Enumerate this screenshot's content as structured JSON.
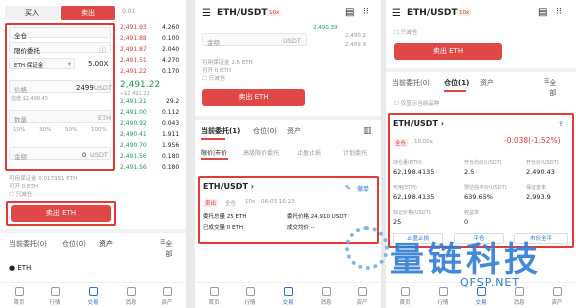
{
  "colors": {
    "sell": "#e04848",
    "buy": "#1f9d55",
    "accent": "#e53935"
  },
  "p1": {
    "tab_buy": "买入",
    "tab_sell": "卖出",
    "header_right": "0.01",
    "full_label": "全仓",
    "limit_label": "限价委托",
    "margin_label": "ETH 保证金",
    "leverage": "5.00X",
    "price_label": "价格",
    "price_value": "2499",
    "price_unit": "USDT",
    "price_approx": "估值 $2,499.45",
    "qty_label": "数量",
    "qty_unit": "ETH",
    "pcts": [
      "10%",
      "30%",
      "50%",
      "100%"
    ],
    "amount_label": "金额",
    "amount_value": "0",
    "amount_unit": "USDT",
    "avail_margin": "可用保证金 0.017351 ETH",
    "avail_open": "可开 0 ETH",
    "reduce_only": "只减仓",
    "sell_btn": "卖出 ETH",
    "orders_tab": "当前委托(0)",
    "positions_tab": "仓位(0)",
    "assets_tab": "资产",
    "all_label": "全部",
    "asset_name": "ETH",
    "asks": [
      [
        "2,491.93",
        "4.260"
      ],
      [
        "2,491.88",
        "0.100"
      ],
      [
        "2,491.87",
        "2.040"
      ],
      [
        "2,491.51",
        "4.270"
      ],
      [
        "2,491.22",
        "0.170"
      ]
    ],
    "last_price": "2,491.22",
    "last_sub": "≈$2,491.22",
    "bids": [
      [
        "2,491.21",
        "29.2"
      ],
      [
        "2,491.00",
        "0.112"
      ],
      [
        "2,490.92",
        "0.043"
      ],
      [
        "2,490.41",
        "1.911"
      ],
      [
        "2,490.70",
        "1.956"
      ],
      [
        "2,491.56",
        "0.180"
      ],
      [
        "2,491.56",
        "0.180"
      ]
    ],
    "nav": [
      "首页",
      "行情",
      "交易",
      "消息",
      "资产"
    ]
  },
  "p2": {
    "pair": "ETH/USDT",
    "lev_badge": "10x",
    "amount_label": "金额",
    "amount_unit": "USDT",
    "side_vals": [
      "2,490.39",
      "2,490.2",
      "2,489.9"
    ],
    "avail_margin": "可用保证金 2.5 ETH",
    "avail_open": "可开 0 ETH",
    "reduce_only": "只减仓",
    "sell_btn": "卖出 ETH",
    "orders_tab": "当前委托(1)",
    "positions_tab": "仓位(0)",
    "assets_tab": "资产",
    "subtabs": [
      "限价|市价",
      "高级限价委托",
      "止盈止损",
      "计划委托"
    ],
    "card_pair": "ETH/USDT",
    "card_link": "撤单",
    "card_side": "卖出",
    "card_mode": "全仓",
    "card_lev": "10x",
    "card_time": "08-03 16:23",
    "card_k1": "委托总量 25 ETH",
    "card_k2": "委托价格 24,910 USDT",
    "card_k3": "已成交量 0 ETH",
    "card_k4": "成交均价 --",
    "nav": [
      "首页",
      "行情",
      "交易",
      "消息",
      "资产"
    ]
  },
  "p3": {
    "pair": "ETH/USDT",
    "lev_badge": "10x",
    "reduce_only": "只减仓",
    "sell_btn": "卖出 ETH",
    "orders_tab": "当前委托(0)",
    "positions_tab": "仓位(1)",
    "assets_tab": "资产",
    "all_label": "全部",
    "show_current": "仅显示当前品种",
    "card_pair": "ETH/USDT",
    "card_mode": "全仓",
    "card_lev": "10.00x",
    "card_pnl": "-0.038(-1.52%)",
    "labels": [
      "持仓量(ETH)",
      "开仓均价(USDT)",
      "开仓价(USDT)",
      "可用(ETH)",
      "预估强平价(USDT)",
      "保证金率",
      "标记价格(USDT)",
      "收益率",
      "保证金(ETH)"
    ],
    "values": [
      "62,198.4135",
      "2.5",
      "2,490.43",
      "62,198.4135",
      "639.65%",
      "2,993.9",
      "25",
      "0",
      ""
    ],
    "btns": [
      "止盈止损",
      "平仓",
      "市价全平"
    ],
    "nav": [
      "首页",
      "行情",
      "交易",
      "消息",
      "资产"
    ]
  },
  "watermark": {
    "brand": "量链科技",
    "site": "QFSP.NET"
  }
}
